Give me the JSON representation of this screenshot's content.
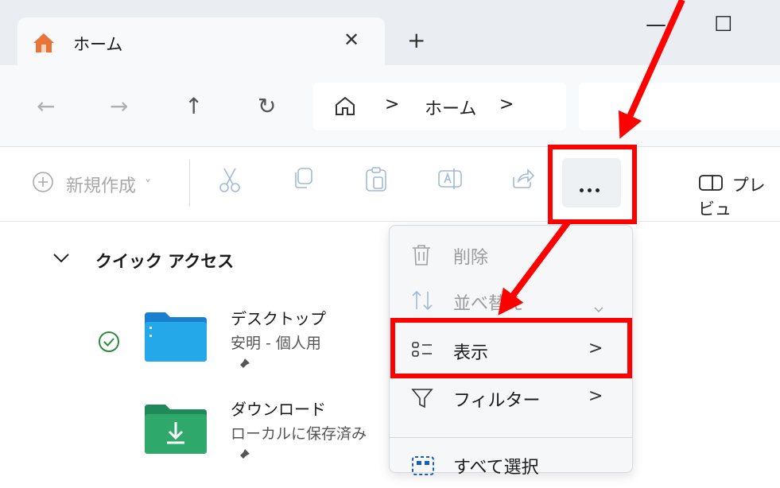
{
  "window": {
    "tab_title": "ホーム",
    "tab_close": "✕",
    "new_tab": "+",
    "minimize": "—",
    "maximize": "☐"
  },
  "nav": {
    "back": "←",
    "forward": "→",
    "up": "↑",
    "refresh": "↻",
    "breadcrumb_sep1": ">",
    "breadcrumb_home": "ホーム",
    "breadcrumb_sep2": ">"
  },
  "toolbar": {
    "new_label": "新規作成",
    "new_chevron": "˅",
    "preview_label": "プレビュ"
  },
  "quick_access": {
    "header": "クイック アクセス",
    "chevron": "∨",
    "items": [
      {
        "name": "デスクトップ",
        "sub": "安明 - 個人用"
      },
      {
        "name": "ダウンロード",
        "sub": "ローカルに保存済み"
      }
    ]
  },
  "menu": {
    "items": [
      {
        "label": "削除"
      },
      {
        "label": "並べ替え"
      },
      {
        "label": "表示",
        "arrow": ">"
      },
      {
        "label": "フィルター",
        "arrow": ">"
      },
      {
        "label": "すべて選択"
      }
    ]
  },
  "colors": {
    "annotation_red": "#ff0000",
    "folder_blue": "#1e9ce6",
    "folder_green": "#2fa86b",
    "sync_green": "#2e8b3d"
  }
}
